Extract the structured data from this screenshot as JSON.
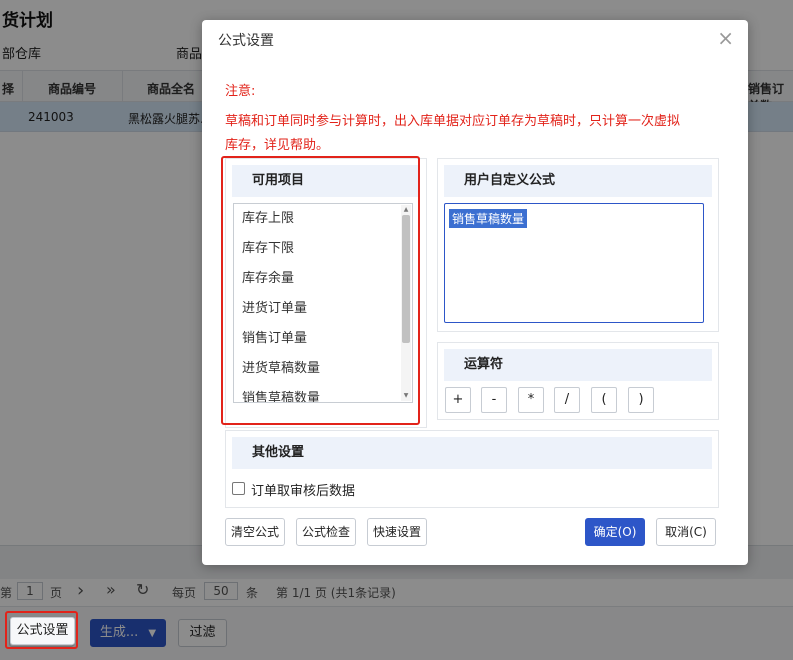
{
  "page": {
    "title": "货计划",
    "filters": [
      "部仓库",
      "商品"
    ]
  },
  "table": {
    "headers": [
      "择",
      "商品编号",
      "商品全名",
      "销售订单数"
    ],
    "row": {
      "code": "241003",
      "name": "黑松露火腿苏..."
    }
  },
  "pager": {
    "prefix": "第",
    "page": "1",
    "page_suffix": "页",
    "next_icon": "›",
    "last_icon": "»",
    "refresh_icon": "↻",
    "per_page_label": "每页",
    "per_page": "50",
    "per_page_suffix": "条",
    "summary": "第 1/1 页 (共1条记录)"
  },
  "footer": {
    "formula_button": "公式设置",
    "generate_button": "生成...",
    "filter_button": "过滤"
  },
  "dialog": {
    "title": "公式设置",
    "notice_title": "注意:",
    "notice_line1": "草稿和订单同时参与计算时，出入库单据对应订单存为草稿时，只计算一次虚拟",
    "notice_line2": "库存，详见帮助。",
    "available_title": "可用项目",
    "available_items": [
      "库存上限",
      "库存下限",
      "库存余量",
      "进货订单量",
      "销售订单量",
      "进货草稿数量",
      "销售草稿数量"
    ],
    "custom_title": "用户自定义公式",
    "custom_formula": "销售草稿数量",
    "operators_title": "运算符",
    "operators": [
      "+",
      "-",
      "*",
      "/",
      "(",
      ")"
    ],
    "other_title": "其他设置",
    "checkbox_label": "订单取审核后数据",
    "clear_button": "清空公式",
    "check_button": "公式检查",
    "quick_button": "快速设置",
    "ok_button": "确定(O)",
    "cancel_button": "取消(C)",
    "close_icon": "×"
  },
  "colors": {
    "primary": "#2d56c8",
    "highlight_frame": "#e2231a",
    "notice": "#e2231a"
  }
}
